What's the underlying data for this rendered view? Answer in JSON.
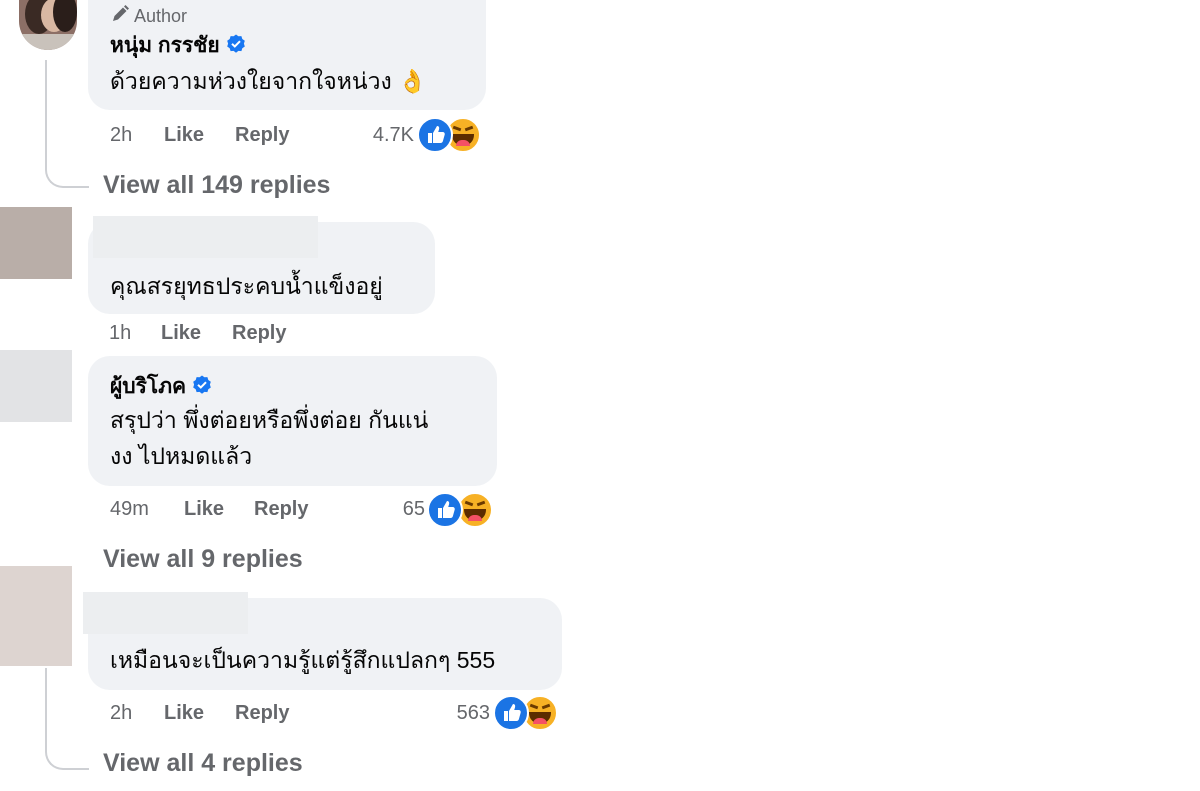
{
  "comments": [
    {
      "author_badge": "Author",
      "name": "หนุ่ม กรรชัย",
      "verified": true,
      "lines": [
        "ด้วยความห่วงใยจากใจหน่วง 👌"
      ],
      "time": "2h",
      "like_label": "Like",
      "reply_label": "Reply",
      "reaction_count": "4.7K",
      "reactions": [
        "like-icon",
        "haha-icon"
      ],
      "view_replies": "View all 149 replies"
    },
    {
      "name": "",
      "lines": [
        "คุณสรยุทธประคบน้ำแข็งอยู่"
      ],
      "time": "1h",
      "like_label": "Like",
      "reply_label": "Reply"
    },
    {
      "name": "ผู้บริโภค",
      "verified": true,
      "lines": [
        "สรุปว่า พึ่งต่อยหรือพึ่งต่อย กันแน่",
        "งง ไปหมดแล้ว"
      ],
      "time": "49m",
      "like_label": "Like",
      "reply_label": "Reply",
      "reaction_count": "65",
      "reactions": [
        "like-icon",
        "haha-icon"
      ],
      "view_replies": "View all 9 replies"
    },
    {
      "name": "",
      "lines": [
        "เหมือนจะเป็นความรู้แต่รู้สึกแปลกๆ 555"
      ],
      "time": "2h",
      "like_label": "Like",
      "reply_label": "Reply",
      "reaction_count": "563",
      "reactions": [
        "like-icon",
        "haha-icon"
      ],
      "view_replies": "View all 4 replies"
    }
  ],
  "colors": {
    "bubble": "#f0f2f5",
    "meta_text": "#65676b",
    "like_blue": "#1b74e4",
    "haha_yellow": "#f7b125",
    "verified_blue": "#1877f2"
  }
}
